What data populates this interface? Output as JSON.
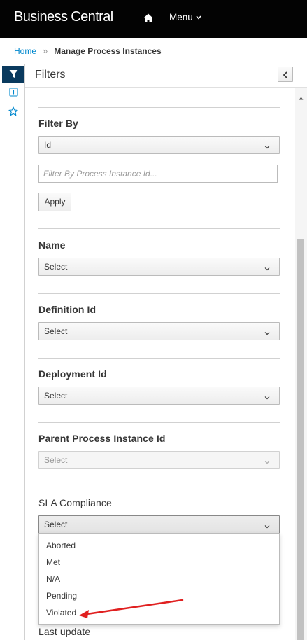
{
  "navbar": {
    "brand": "Business Central",
    "menu_label": "Menu"
  },
  "breadcrumb": {
    "home": "Home",
    "current": "Manage Process Instances"
  },
  "filters": {
    "title": "Filters",
    "filter_by": {
      "label": "Filter By",
      "selected": "Id",
      "input_placeholder": "Filter By Process Instance Id...",
      "apply_label": "Apply"
    },
    "name": {
      "label": "Name",
      "selected": "Select"
    },
    "definition_id": {
      "label": "Definition Id",
      "selected": "Select"
    },
    "deployment_id": {
      "label": "Deployment Id",
      "selected": "Select"
    },
    "parent_process_instance_id": {
      "label": "Parent Process Instance Id",
      "selected": "Select"
    },
    "sla_compliance": {
      "label": "SLA Compliance",
      "selected": "Select",
      "options": [
        "Aborted",
        "Met",
        "N/A",
        "Pending",
        "Violated"
      ]
    },
    "last_update": {
      "label": "Last update"
    }
  },
  "colors": {
    "navbar_bg": "#030303",
    "link": "#0088ce",
    "active_toolbar": "#0a3a5e",
    "annotation_arrow": "#e02020"
  },
  "icons": [
    "home-icon",
    "chevron-down-icon",
    "filter-icon",
    "add-square-icon",
    "star-icon",
    "chevron-left-icon",
    "scroll-up-icon"
  ]
}
